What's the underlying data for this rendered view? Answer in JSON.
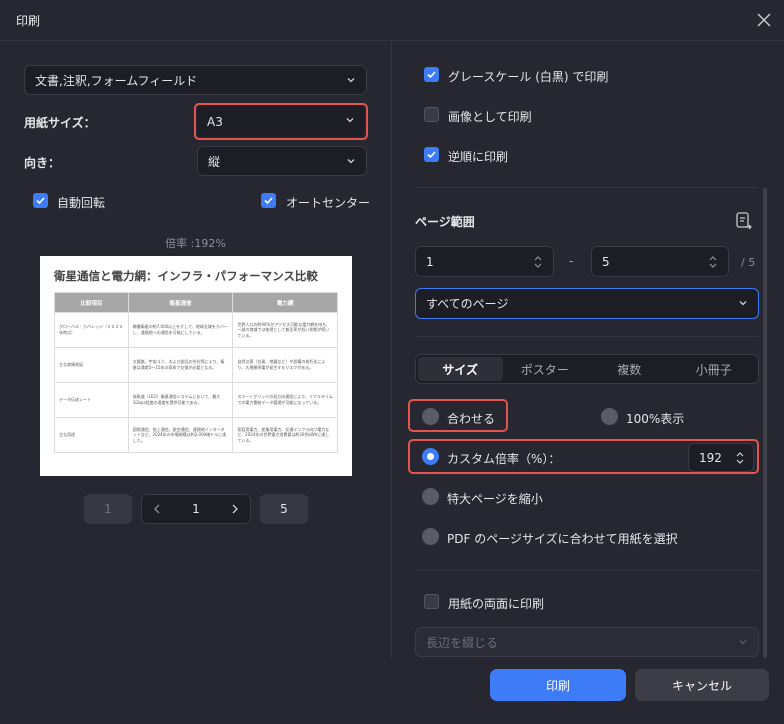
{
  "dialog": {
    "title": "印刷"
  },
  "left": {
    "content_select": "文書,注釈,フォームフィールド",
    "paper_size_label": "用紙サイズ：",
    "paper_size_value": "A3",
    "orientation_label": "向き：",
    "orientation_value": "縦",
    "auto_rotate": "自動回転",
    "auto_center": "オートセンター",
    "scale_text": "倍率 :192%",
    "preview": {
      "title": "衛星通信と電力網：インフラ・パフォーマンス比較",
      "headers": [
        "比較項目",
        "衛星通信",
        "電力網"
      ],
      "rows": [
        [
          "グローバル・カバレッジ（２０２４年時点）",
          "稼働衛星の約7,000以上を介して、地球全域をカバーし、遠隔地への通信を可能にしている。",
          "世界人口の約90%がアクセス可能な電力網を持ち、一部の地域では依然として普及率が低い状態が続いている。"
        ],
        [
          "主な故障原因",
          "太陽嵐、宇宙ゴミ、および部品の劣化等により、衛星は通常5〜15年の寿命で交換が必要となる。",
          "自然災害（台風、地震など）や設備の老朽化により、大規模停電が発生するリスクがある。"
        ],
        [
          "データ伝送レート",
          "低軌道（LEO）衛星通信システムにおいて、最大1Gbps程度の速度を提供可能である。",
          "スマートグリッドの双方向通信により、リアルタイムでの電力需給データ管理が可能になっている。"
        ],
        [
          "主な用途",
          "国際通信、船上通信、航空通信、遠隔地インターネットなど、2024年の市場規模は約2,000億ドルに達した。",
          "家庭用電力、産業用電力、交通インフラ向け電力など、2024年の世界電力消費量は約30兆kWhに達している。"
        ]
      ]
    },
    "pager": {
      "first": "1",
      "current": "1",
      "last": "5"
    }
  },
  "right": {
    "grayscale": "グレースケール (白黒) で印刷",
    "as_image": "画像として印刷",
    "reverse": "逆順に印刷",
    "page_range_label": "ページ範囲",
    "range_from": "1",
    "range_dash": "-",
    "range_to": "5",
    "range_total": "/ 5",
    "pages_select": "すべてのページ",
    "tabs": [
      "サイズ",
      "ポスター",
      "複数",
      "小冊子"
    ],
    "fit": "合わせる",
    "actual": "100%表示",
    "custom_scale": "カスタム倍率（%）：",
    "custom_value": "192",
    "shrink": "特大ページを縮小",
    "pdf_size": "PDF のページサイズに合わせて用紙を選択",
    "duplex": "用紙の両面に印刷",
    "binding_placeholder": "長辺を綴じる"
  },
  "buttons": {
    "print": "印刷",
    "cancel": "キャンセル"
  },
  "colors": {
    "accent": "#3d7bf7",
    "highlight": "#e5554f",
    "background": "#262730"
  }
}
